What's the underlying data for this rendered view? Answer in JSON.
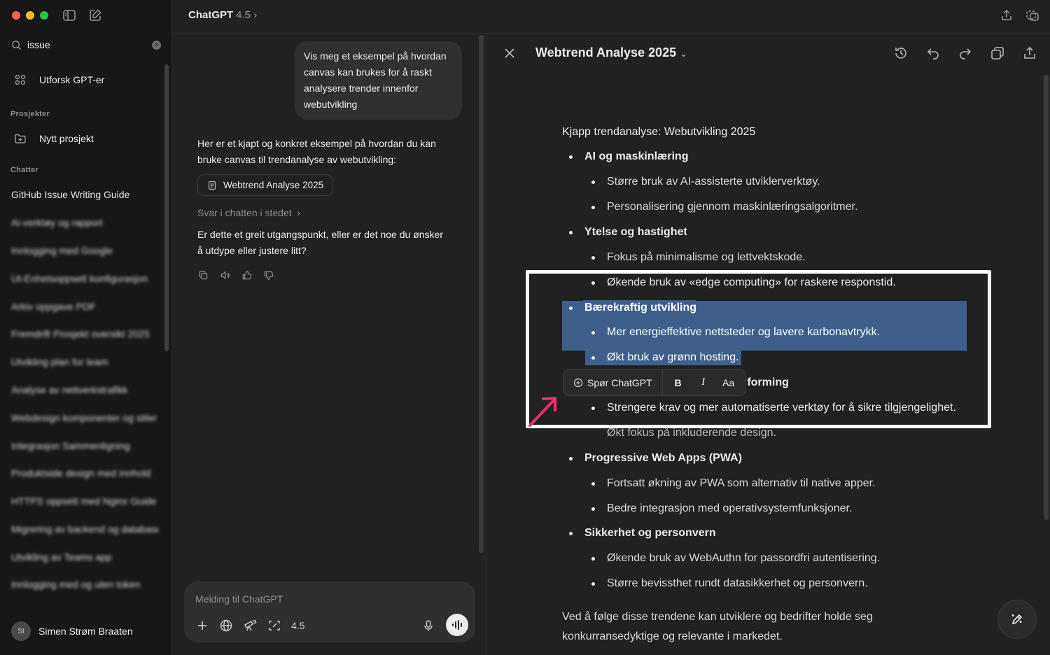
{
  "app": {
    "model_name": "ChatGPT",
    "model_version": "4.5"
  },
  "sidebar": {
    "search_query": "issue",
    "explore_label": "Utforsk GPT-er",
    "projects_header": "Prosjekter",
    "new_project_label": "Nytt prosjekt",
    "chats_header": "Chatter",
    "chats": [
      {
        "label": "GitHub Issue Writing Guide",
        "blurred": false
      },
      {
        "label": "Ai-verktøy og rapport",
        "blurred": true
      },
      {
        "label": "Innlogging med Google",
        "blurred": true
      },
      {
        "label": "Ut-Enhetsoppsett konfigurasjon",
        "blurred": true
      },
      {
        "label": "Arkiv oppgave PDF",
        "blurred": true
      },
      {
        "label": "Fremdrift Prosjekt oversikt 2025",
        "blurred": true
      },
      {
        "label": "Utvikling plan for team",
        "blurred": true
      },
      {
        "label": "Analyse av nettverkstrafikk",
        "blurred": true
      },
      {
        "label": "Webdesign komponenter og stiler",
        "blurred": true
      },
      {
        "label": "Integrasjon Sammenligning",
        "blurred": true
      },
      {
        "label": "Produktside design med innhold",
        "blurred": true
      },
      {
        "label": "HTTPS oppsett med Nginx Guide",
        "blurred": true
      },
      {
        "label": "Migrering av backend og database",
        "blurred": true
      },
      {
        "label": "Utvikling av Teams app",
        "blurred": true
      },
      {
        "label": "Innlogging med og uten token",
        "blurred": true
      }
    ],
    "user_initials": "SI",
    "user_name": "Simen Strøm Braaten"
  },
  "chat": {
    "user_message": "Vis meg et eksempel på hvordan canvas kan brukes for å raskt analysere trender innenfor webutvikling",
    "assistant_intro": "Her er et kjapt og konkret eksempel på hvordan du kan bruke canvas til trendanalyse av webutvikling:",
    "canvas_chip": "Webtrend Analyse 2025",
    "reply_in_chat": "Svar i chatten i stedet",
    "assistant_followup": "Er dette et greit utgangspunkt, eller er det noe du ønsker å utdype eller justere litt?",
    "composer_placeholder": "Melding til ChatGPT",
    "composer_model": "4.5"
  },
  "canvas": {
    "title": "Webtrend Analyse 2025",
    "heading": "Kjapp trendanalyse: Webutvikling 2025",
    "sections": [
      {
        "title": "AI og maskinlæring",
        "items": [
          "Større bruk av AI-assisterte utviklerverktøy.",
          "Personalisering gjennom maskinlæringsalgoritmer."
        ]
      },
      {
        "title": "Ytelse og hastighet",
        "items": [
          "Fokus på minimalisme og lettvektskode.",
          "Økende bruk av «edge computing» for raskere responstid."
        ]
      },
      {
        "title": "Bærekraftig utvikling",
        "items": [
          "Mer energieffektive nettsteder og lavere karbonavtrykk.",
          "Økt bruk av grønn hosting."
        ]
      },
      {
        "title": ":forming",
        "items": [
          "Strengere krav og mer automatiserte verktøy for å sikre tilgjengelighet.",
          "Økt fokus på inkluderende design."
        ]
      },
      {
        "title": "Progressive Web Apps (PWA)",
        "items": [
          "Fortsatt økning av PWA som alternativ til native apper.",
          "Bedre integrasjon med operativsystemfunksjoner."
        ]
      },
      {
        "title": "Sikkerhet og personvern",
        "items": [
          "Økende bruk av WebAuthn for passordfri autentisering.",
          "Større bevissthet rundt datasikkerhet og personvern."
        ]
      }
    ],
    "footer": "Ved å følge disse trendene kan utviklere og bedrifter holde seg konkurransedyktige og relevante i markedet.",
    "toolbar": {
      "ask": "Spør ChatGPT",
      "bold": "B",
      "italic": "I",
      "text_size": "Aa"
    }
  },
  "colors": {
    "selection": "#3e5f8c",
    "annotation_arrow": "#e8336d",
    "highlight_box": "#ffffff"
  }
}
